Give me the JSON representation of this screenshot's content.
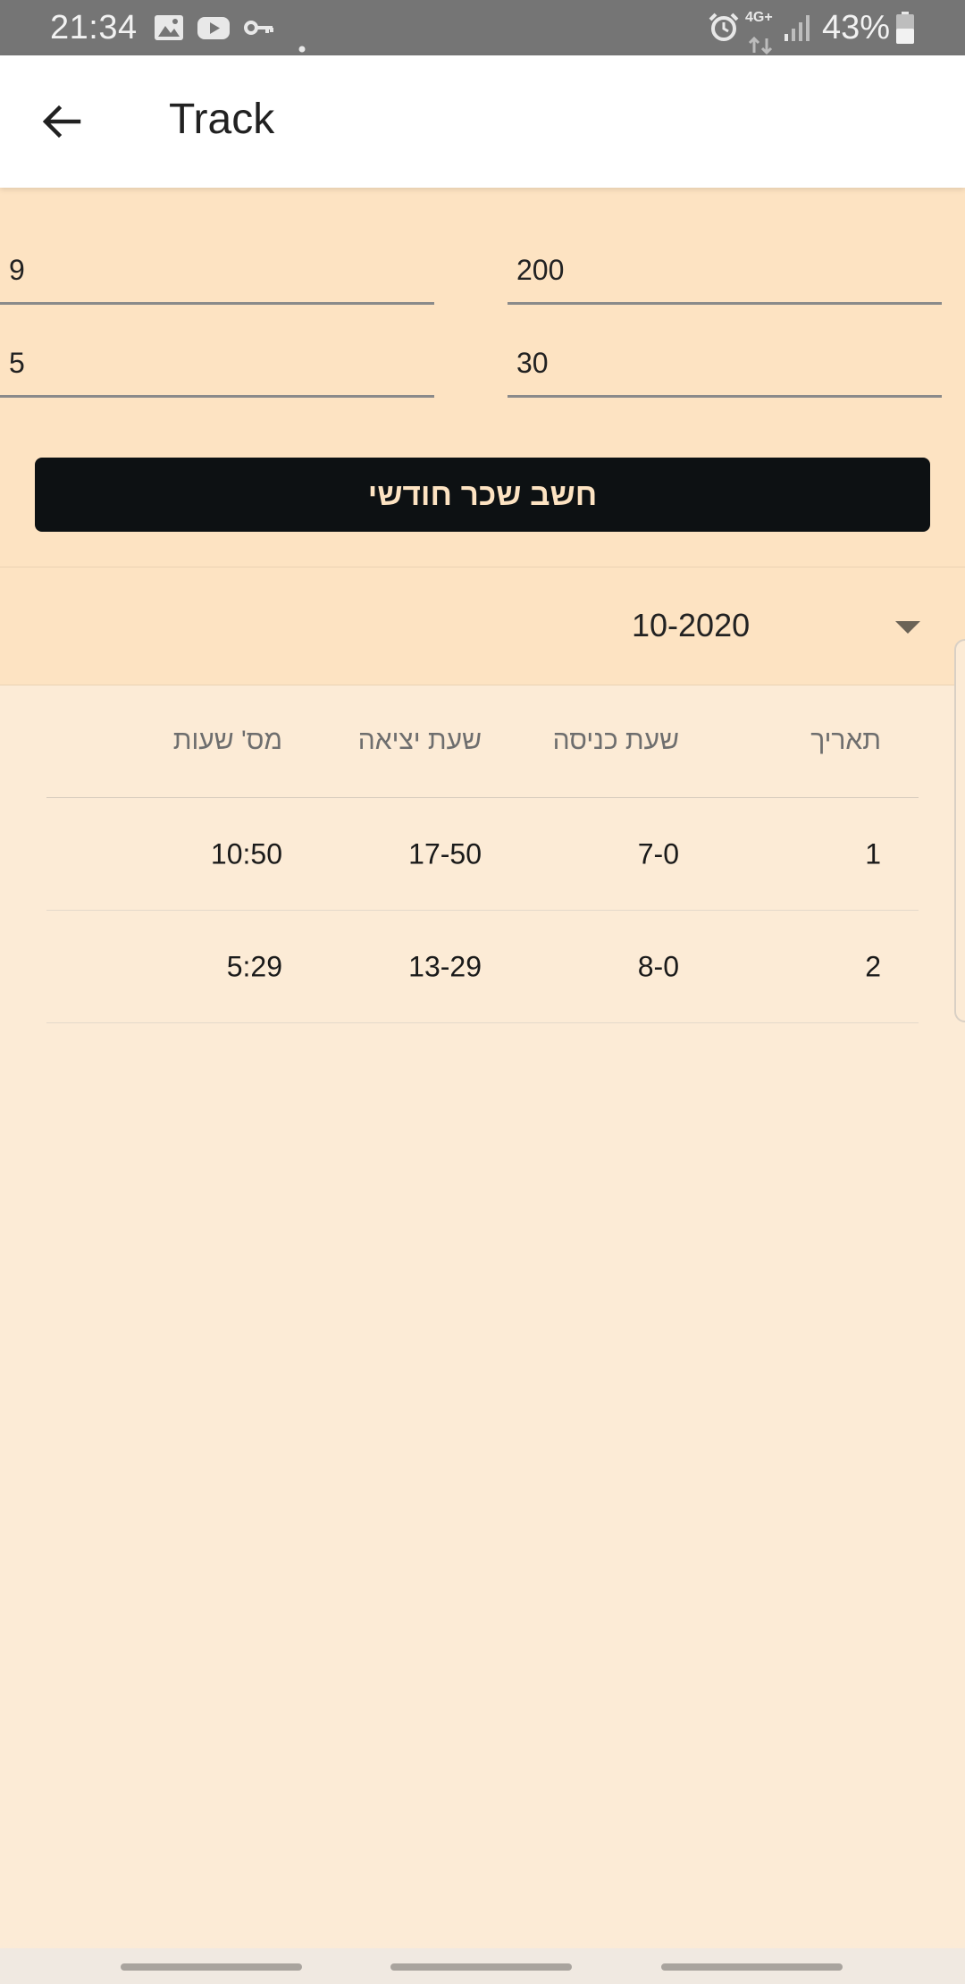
{
  "status_bar": {
    "time": "21:34",
    "network": "4G+",
    "battery": "43%",
    "icons": [
      "image-icon",
      "youtube-icon",
      "key-icon",
      "dot-icon",
      "alarm-icon",
      "network-4g-icon",
      "signal-icon",
      "battery-icon"
    ]
  },
  "app_bar": {
    "title": "Track",
    "back_icon": "arrow-back-icon"
  },
  "form": {
    "field_left_1": "9",
    "field_right_1": "200",
    "field_left_2": "5",
    "field_right_2": "30",
    "calculate_button": "חשב שכר חודשי"
  },
  "month_selector": {
    "value": "10-2020",
    "icon": "dropdown-arrow-icon"
  },
  "table": {
    "headers": {
      "date": "תאריך",
      "entry_time": "שעת כניסה",
      "exit_time": "שעת יציאה",
      "hours": "מס' שעות"
    },
    "rows": [
      {
        "date": "1",
        "entry_time": "7-0",
        "exit_time": "17-50",
        "hours": "10:50"
      },
      {
        "date": "2",
        "entry_time": "8-0",
        "exit_time": "13-29",
        "hours": "5:29"
      }
    ]
  },
  "colors": {
    "status_bar": "#757575",
    "app_bar": "#ffffff",
    "form_background": "#fde3c2",
    "page_background": "#fcebd6",
    "button_background": "#0d1113",
    "button_text": "#fde3c2"
  }
}
